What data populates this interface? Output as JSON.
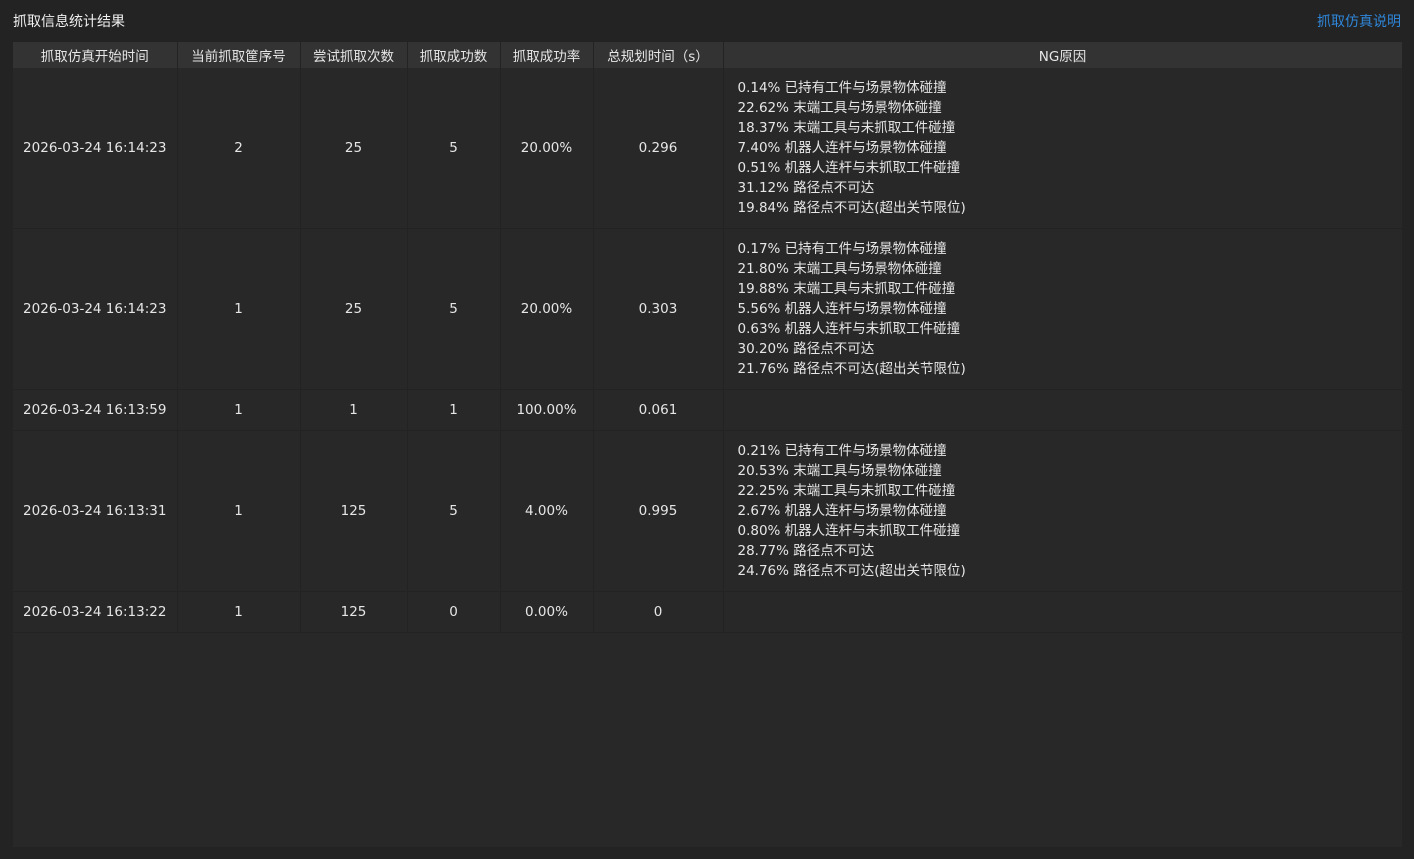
{
  "header": {
    "title": "抓取信息统计结果",
    "help_link": "抓取仿真说明"
  },
  "table": {
    "columns": [
      "抓取仿真开始时间",
      "当前抓取筐序号",
      "尝试抓取次数",
      "抓取成功数",
      "抓取成功率",
      "总规划时间（s）",
      "NG原因"
    ],
    "rows": [
      {
        "start_time": "2026-03-24 16:14:23",
        "basket_no": "2",
        "attempts": "25",
        "successes": "5",
        "success_rate": "20.00%",
        "plan_time": "0.296",
        "ng_reasons": [
          "0.14% 已持有工件与场景物体碰撞",
          "22.62% 末端工具与场景物体碰撞",
          "18.37% 末端工具与未抓取工件碰撞",
          "7.40% 机器人连杆与场景物体碰撞",
          "0.51% 机器人连杆与未抓取工件碰撞",
          "31.12% 路径点不可达",
          "19.84% 路径点不可达(超出关节限位)"
        ]
      },
      {
        "start_time": "2026-03-24 16:14:23",
        "basket_no": "1",
        "attempts": "25",
        "successes": "5",
        "success_rate": "20.00%",
        "plan_time": "0.303",
        "ng_reasons": [
          "0.17% 已持有工件与场景物体碰撞",
          "21.80% 末端工具与场景物体碰撞",
          "19.88% 末端工具与未抓取工件碰撞",
          "5.56% 机器人连杆与场景物体碰撞",
          "0.63% 机器人连杆与未抓取工件碰撞",
          "30.20% 路径点不可达",
          "21.76% 路径点不可达(超出关节限位)"
        ]
      },
      {
        "start_time": "2026-03-24 16:13:59",
        "basket_no": "1",
        "attempts": "1",
        "successes": "1",
        "success_rate": "100.00%",
        "plan_time": "0.061",
        "ng_reasons": []
      },
      {
        "start_time": "2026-03-24 16:13:31",
        "basket_no": "1",
        "attempts": "125",
        "successes": "5",
        "success_rate": "4.00%",
        "plan_time": "0.995",
        "ng_reasons": [
          "0.21% 已持有工件与场景物体碰撞",
          "20.53% 末端工具与场景物体碰撞",
          "22.25% 末端工具与未抓取工件碰撞",
          "2.67% 机器人连杆与场景物体碰撞",
          "0.80% 机器人连杆与未抓取工件碰撞",
          "28.77% 路径点不可达",
          "24.76% 路径点不可达(超出关节限位)"
        ]
      },
      {
        "start_time": "2026-03-24 16:13:22",
        "basket_no": "1",
        "attempts": "125",
        "successes": "0",
        "success_rate": "0.00%",
        "plan_time": "0",
        "ng_reasons": []
      }
    ]
  },
  "colors": {
    "background": "#232323",
    "table_background": "#282828",
    "header_background": "#333333",
    "text": "#e6e6e6",
    "link": "#2f86d8"
  }
}
